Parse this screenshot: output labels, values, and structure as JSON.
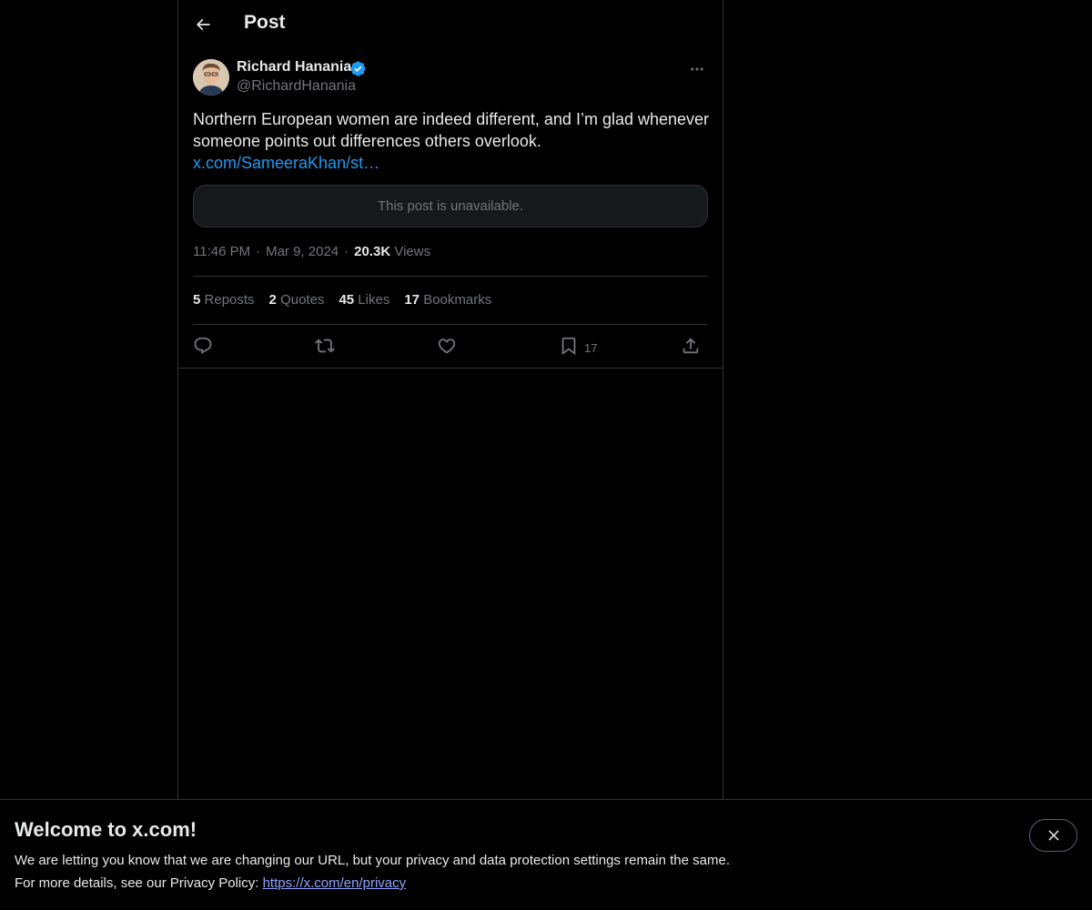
{
  "header": {
    "title": "Post"
  },
  "post": {
    "author_name": "Richard Hanania",
    "author_handle": "@RichardHanania",
    "text": "Northern European women are indeed different, and I’m glad whenever someone points out differences others overlook.",
    "link_text": "x.com/SameeraKhan/st…",
    "quoted_unavailable": "This post is unavailable.",
    "time": "11:46 PM",
    "date": "Mar 9, 2024",
    "views_count": "20.3K",
    "views_label": "Views"
  },
  "stats": {
    "reposts_count": "5",
    "reposts_label": "Reposts",
    "quotes_count": "2",
    "quotes_label": "Quotes",
    "likes_count": "45",
    "likes_label": "Likes",
    "bookmarks_count": "17",
    "bookmarks_label": "Bookmarks"
  },
  "actions": {
    "bookmark_count": "17"
  },
  "banner": {
    "title": "Welcome to x.com!",
    "line1": "We are letting you know that we are changing our URL, but your privacy and data protection settings remain the same.",
    "line2_prefix": "For more details, see our Privacy Policy: ",
    "privacy_link": "https://x.com/en/privacy"
  },
  "colors": {
    "background": "#000000",
    "text_primary": "#e7e9ea",
    "text_secondary": "#71767b",
    "accent": "#1d9bf0",
    "border": "#2f3336",
    "link_banner": "#8ea4ff"
  },
  "icons": [
    "back-arrow-icon",
    "verified-badge-icon",
    "more-icon",
    "reply-icon",
    "repost-icon",
    "like-icon",
    "bookmark-icon",
    "share-icon",
    "close-icon"
  ]
}
